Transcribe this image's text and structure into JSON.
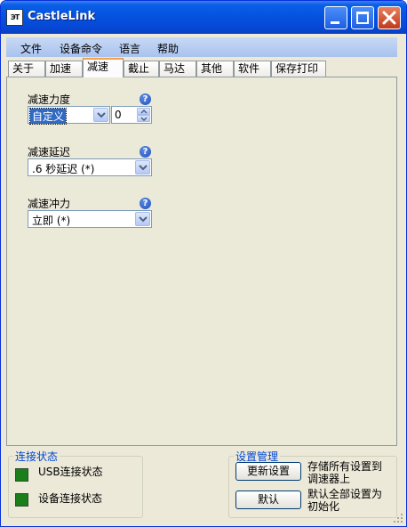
{
  "window": {
    "title": "CastleLink",
    "app_icon_text": "ЭТ"
  },
  "menu": [
    "文件",
    "设备命令",
    "语言",
    "帮助"
  ],
  "tabs": [
    "关于",
    "加速",
    "减速",
    "截止",
    "马达",
    "其他",
    "软件",
    "保存打印"
  ],
  "active_tab": "减速",
  "fields": {
    "brake_strength": {
      "label": "减速力度",
      "value": "自定义",
      "spin_value": "0"
    },
    "brake_delay": {
      "label": "减速延迟",
      "value": ".6 秒延迟 (*)"
    },
    "brake_punch": {
      "label": "减速冲力",
      "value": "立即 (*)"
    },
    "help_glyph": "?"
  },
  "connection": {
    "title": "连接状态",
    "usb_label": "USB连接状态",
    "device_label": "设备连接状态",
    "led_color": "#1a7f1a"
  },
  "settings": {
    "title": "设置管理",
    "update_button": "更新设置",
    "update_desc_1": "存储所有设置到",
    "update_desc_2": "调速器上",
    "default_button": "默认",
    "default_desc_1": "默认全部设置为",
    "default_desc_2": "初始化"
  },
  "colors": {
    "titlebar": "#0553e0",
    "background": "#ece9d8",
    "group_title": "#0046d5",
    "selection": "#316ac5",
    "active_tab_accent": "#f1a24c"
  }
}
